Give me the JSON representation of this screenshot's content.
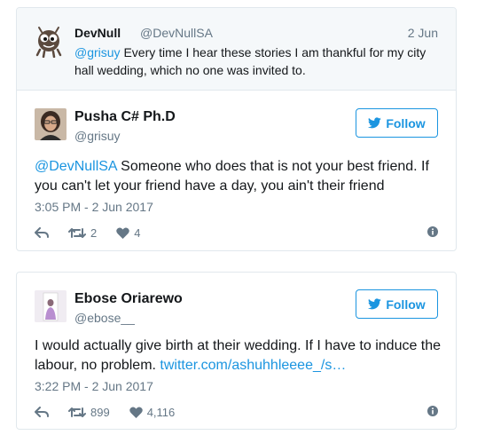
{
  "colors": {
    "link": "#1b95e0",
    "muted": "#657786",
    "border": "#e1e8ed",
    "context_bg": "#f5f8fa"
  },
  "tweet1": {
    "reply_context": {
      "name": "DevNull",
      "handle": "@DevNullSA",
      "date": "2 Jun",
      "mention": "@grisuy",
      "text": " Every time I hear these stories I am thankful for my city hall wedding, which no one was invited to."
    },
    "author": {
      "name": "Pusha C# Ph.D",
      "handle": "@grisuy"
    },
    "follow_label": "Follow",
    "mention": "@DevNullSA",
    "text": " Someone who does that is not your best friend. If you can't let your friend have a day, you ain't their friend",
    "timestamp": "3:05 PM - 2 Jun 2017",
    "retweets": "2",
    "likes": "4"
  },
  "tweet2": {
    "author": {
      "name": "Ebose Oriarewo",
      "handle": "@ebose__"
    },
    "follow_label": "Follow",
    "text": "I would actually give birth at their wedding. If I have to induce the labour, no problem. ",
    "link": "twitter.com/ashuhhleeee_/s…",
    "timestamp": "3:22 PM - 2 Jun 2017",
    "retweets": "899",
    "likes": "4,116"
  },
  "icons": [
    "reply-icon",
    "retweet-icon",
    "like-icon",
    "info-icon",
    "twitter-bird-icon"
  ]
}
